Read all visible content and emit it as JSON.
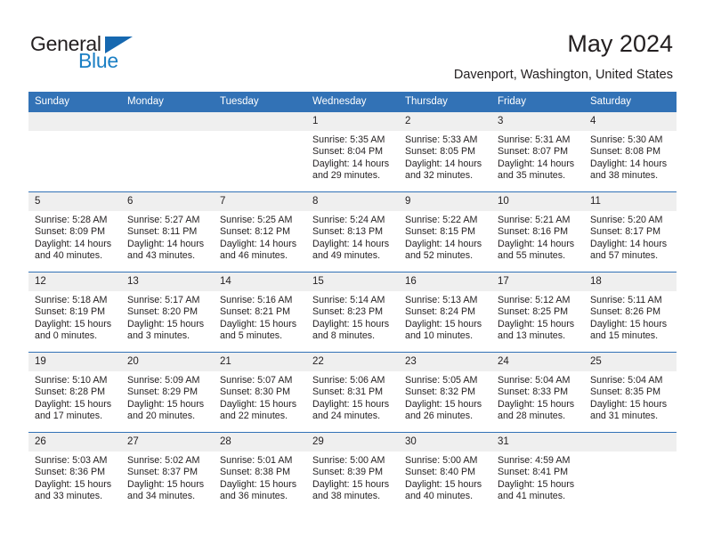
{
  "brand": {
    "name_top": "General",
    "name_bottom": "Blue",
    "accent_color": "#1668b0",
    "text_color": "#231f20"
  },
  "header": {
    "title": "May 2024",
    "subtitle": "Davenport, Washington, United States",
    "header_bg_color": "#3272b6",
    "daynum_bg_color": "#efefef"
  },
  "weekdays": [
    "Sunday",
    "Monday",
    "Tuesday",
    "Wednesday",
    "Thursday",
    "Friday",
    "Saturday"
  ],
  "weeks": [
    [
      {
        "day": "",
        "sunrise": "",
        "sunset": "",
        "daylight_line1": "",
        "daylight_line2": ""
      },
      {
        "day": "",
        "sunrise": "",
        "sunset": "",
        "daylight_line1": "",
        "daylight_line2": ""
      },
      {
        "day": "",
        "sunrise": "",
        "sunset": "",
        "daylight_line1": "",
        "daylight_line2": ""
      },
      {
        "day": "1",
        "sunrise": "Sunrise: 5:35 AM",
        "sunset": "Sunset: 8:04 PM",
        "daylight_line1": "Daylight: 14 hours",
        "daylight_line2": "and 29 minutes."
      },
      {
        "day": "2",
        "sunrise": "Sunrise: 5:33 AM",
        "sunset": "Sunset: 8:05 PM",
        "daylight_line1": "Daylight: 14 hours",
        "daylight_line2": "and 32 minutes."
      },
      {
        "day": "3",
        "sunrise": "Sunrise: 5:31 AM",
        "sunset": "Sunset: 8:07 PM",
        "daylight_line1": "Daylight: 14 hours",
        "daylight_line2": "and 35 minutes."
      },
      {
        "day": "4",
        "sunrise": "Sunrise: 5:30 AM",
        "sunset": "Sunset: 8:08 PM",
        "daylight_line1": "Daylight: 14 hours",
        "daylight_line2": "and 38 minutes."
      }
    ],
    [
      {
        "day": "5",
        "sunrise": "Sunrise: 5:28 AM",
        "sunset": "Sunset: 8:09 PM",
        "daylight_line1": "Daylight: 14 hours",
        "daylight_line2": "and 40 minutes."
      },
      {
        "day": "6",
        "sunrise": "Sunrise: 5:27 AM",
        "sunset": "Sunset: 8:11 PM",
        "daylight_line1": "Daylight: 14 hours",
        "daylight_line2": "and 43 minutes."
      },
      {
        "day": "7",
        "sunrise": "Sunrise: 5:25 AM",
        "sunset": "Sunset: 8:12 PM",
        "daylight_line1": "Daylight: 14 hours",
        "daylight_line2": "and 46 minutes."
      },
      {
        "day": "8",
        "sunrise": "Sunrise: 5:24 AM",
        "sunset": "Sunset: 8:13 PM",
        "daylight_line1": "Daylight: 14 hours",
        "daylight_line2": "and 49 minutes."
      },
      {
        "day": "9",
        "sunrise": "Sunrise: 5:22 AM",
        "sunset": "Sunset: 8:15 PM",
        "daylight_line1": "Daylight: 14 hours",
        "daylight_line2": "and 52 minutes."
      },
      {
        "day": "10",
        "sunrise": "Sunrise: 5:21 AM",
        "sunset": "Sunset: 8:16 PM",
        "daylight_line1": "Daylight: 14 hours",
        "daylight_line2": "and 55 minutes."
      },
      {
        "day": "11",
        "sunrise": "Sunrise: 5:20 AM",
        "sunset": "Sunset: 8:17 PM",
        "daylight_line1": "Daylight: 14 hours",
        "daylight_line2": "and 57 minutes."
      }
    ],
    [
      {
        "day": "12",
        "sunrise": "Sunrise: 5:18 AM",
        "sunset": "Sunset: 8:19 PM",
        "daylight_line1": "Daylight: 15 hours",
        "daylight_line2": "and 0 minutes."
      },
      {
        "day": "13",
        "sunrise": "Sunrise: 5:17 AM",
        "sunset": "Sunset: 8:20 PM",
        "daylight_line1": "Daylight: 15 hours",
        "daylight_line2": "and 3 minutes."
      },
      {
        "day": "14",
        "sunrise": "Sunrise: 5:16 AM",
        "sunset": "Sunset: 8:21 PM",
        "daylight_line1": "Daylight: 15 hours",
        "daylight_line2": "and 5 minutes."
      },
      {
        "day": "15",
        "sunrise": "Sunrise: 5:14 AM",
        "sunset": "Sunset: 8:23 PM",
        "daylight_line1": "Daylight: 15 hours",
        "daylight_line2": "and 8 minutes."
      },
      {
        "day": "16",
        "sunrise": "Sunrise: 5:13 AM",
        "sunset": "Sunset: 8:24 PM",
        "daylight_line1": "Daylight: 15 hours",
        "daylight_line2": "and 10 minutes."
      },
      {
        "day": "17",
        "sunrise": "Sunrise: 5:12 AM",
        "sunset": "Sunset: 8:25 PM",
        "daylight_line1": "Daylight: 15 hours",
        "daylight_line2": "and 13 minutes."
      },
      {
        "day": "18",
        "sunrise": "Sunrise: 5:11 AM",
        "sunset": "Sunset: 8:26 PM",
        "daylight_line1": "Daylight: 15 hours",
        "daylight_line2": "and 15 minutes."
      }
    ],
    [
      {
        "day": "19",
        "sunrise": "Sunrise: 5:10 AM",
        "sunset": "Sunset: 8:28 PM",
        "daylight_line1": "Daylight: 15 hours",
        "daylight_line2": "and 17 minutes."
      },
      {
        "day": "20",
        "sunrise": "Sunrise: 5:09 AM",
        "sunset": "Sunset: 8:29 PM",
        "daylight_line1": "Daylight: 15 hours",
        "daylight_line2": "and 20 minutes."
      },
      {
        "day": "21",
        "sunrise": "Sunrise: 5:07 AM",
        "sunset": "Sunset: 8:30 PM",
        "daylight_line1": "Daylight: 15 hours",
        "daylight_line2": "and 22 minutes."
      },
      {
        "day": "22",
        "sunrise": "Sunrise: 5:06 AM",
        "sunset": "Sunset: 8:31 PM",
        "daylight_line1": "Daylight: 15 hours",
        "daylight_line2": "and 24 minutes."
      },
      {
        "day": "23",
        "sunrise": "Sunrise: 5:05 AM",
        "sunset": "Sunset: 8:32 PM",
        "daylight_line1": "Daylight: 15 hours",
        "daylight_line2": "and 26 minutes."
      },
      {
        "day": "24",
        "sunrise": "Sunrise: 5:04 AM",
        "sunset": "Sunset: 8:33 PM",
        "daylight_line1": "Daylight: 15 hours",
        "daylight_line2": "and 28 minutes."
      },
      {
        "day": "25",
        "sunrise": "Sunrise: 5:04 AM",
        "sunset": "Sunset: 8:35 PM",
        "daylight_line1": "Daylight: 15 hours",
        "daylight_line2": "and 31 minutes."
      }
    ],
    [
      {
        "day": "26",
        "sunrise": "Sunrise: 5:03 AM",
        "sunset": "Sunset: 8:36 PM",
        "daylight_line1": "Daylight: 15 hours",
        "daylight_line2": "and 33 minutes."
      },
      {
        "day": "27",
        "sunrise": "Sunrise: 5:02 AM",
        "sunset": "Sunset: 8:37 PM",
        "daylight_line1": "Daylight: 15 hours",
        "daylight_line2": "and 34 minutes."
      },
      {
        "day": "28",
        "sunrise": "Sunrise: 5:01 AM",
        "sunset": "Sunset: 8:38 PM",
        "daylight_line1": "Daylight: 15 hours",
        "daylight_line2": "and 36 minutes."
      },
      {
        "day": "29",
        "sunrise": "Sunrise: 5:00 AM",
        "sunset": "Sunset: 8:39 PM",
        "daylight_line1": "Daylight: 15 hours",
        "daylight_line2": "and 38 minutes."
      },
      {
        "day": "30",
        "sunrise": "Sunrise: 5:00 AM",
        "sunset": "Sunset: 8:40 PM",
        "daylight_line1": "Daylight: 15 hours",
        "daylight_line2": "and 40 minutes."
      },
      {
        "day": "31",
        "sunrise": "Sunrise: 4:59 AM",
        "sunset": "Sunset: 8:41 PM",
        "daylight_line1": "Daylight: 15 hours",
        "daylight_line2": "and 41 minutes."
      },
      {
        "day": "",
        "sunrise": "",
        "sunset": "",
        "daylight_line1": "",
        "daylight_line2": ""
      }
    ]
  ]
}
